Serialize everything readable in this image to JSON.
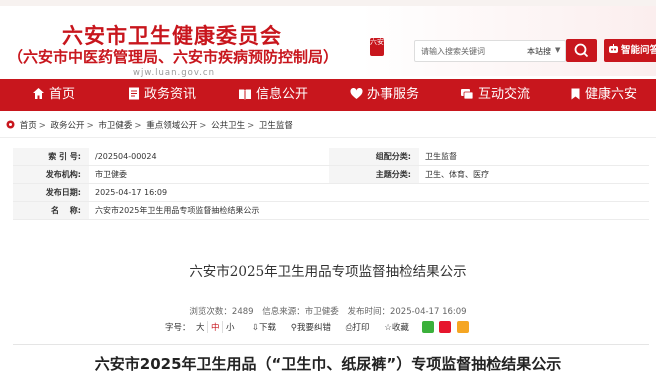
{
  "header": {
    "title": "六安市卫生健康委员会",
    "subtitle": "（六安市中医药管理局、六安市疾病预防控制局）",
    "url": "wjw.luan.gov.cn",
    "search": {
      "placeholder": "请输入搜索关键词",
      "scope": "本站搜",
      "caret": "▼"
    },
    "robot_label": "智能问答"
  },
  "nav": {
    "items": [
      {
        "label": "首页",
        "icon": "home-icon"
      },
      {
        "label": "政务资讯",
        "icon": "document-icon"
      },
      {
        "label": "信息公开",
        "icon": "book-icon"
      },
      {
        "label": "办事服务",
        "icon": "heart-icon"
      },
      {
        "label": "互动交流",
        "icon": "chat-icon"
      },
      {
        "label": "健康六安",
        "icon": "bookmark-icon"
      }
    ]
  },
  "breadcrumb": {
    "items": [
      "首页",
      "政务公开",
      "市卫健委",
      "重点领域公开",
      "公共卫生",
      "卫生监督"
    ],
    "separator": ">"
  },
  "meta": {
    "index_label": "索 引 号:",
    "index_value": "/202504-00024",
    "category_label": "组配分类:",
    "category_value": "卫生监督",
    "org_label": "发布机构:",
    "org_value": "市卫健委",
    "topic_label": "主题分类:",
    "topic_value": "卫生、体育、医疗",
    "date_label": "发布日期:",
    "date_value": "2025-04-17 16:09",
    "name_label": "名　 称:",
    "name_value": "六安市2025年卫生用品专项监督抽检结果公示"
  },
  "article": {
    "title": "六安市2025年卫生用品专项监督抽检结果公示",
    "views": "浏览次数：2489",
    "source": "信息来源：市卫健委",
    "published": "发布时间：2025-04-17 16:09",
    "font_label": "字号：",
    "font_sizes": [
      "大",
      "中",
      "小"
    ],
    "download": "下载",
    "proofread": "我要纠错",
    "print": "打印",
    "favorite": "收藏",
    "body_title": "六安市2025年卫生用品（“卫生巾、纸尿裤”）专项监督抽检结果公示"
  },
  "colors": {
    "brand": "#c8161d",
    "wechat": "#3bb03b",
    "weibo": "#e6162d",
    "qzone": "#f5a623"
  }
}
